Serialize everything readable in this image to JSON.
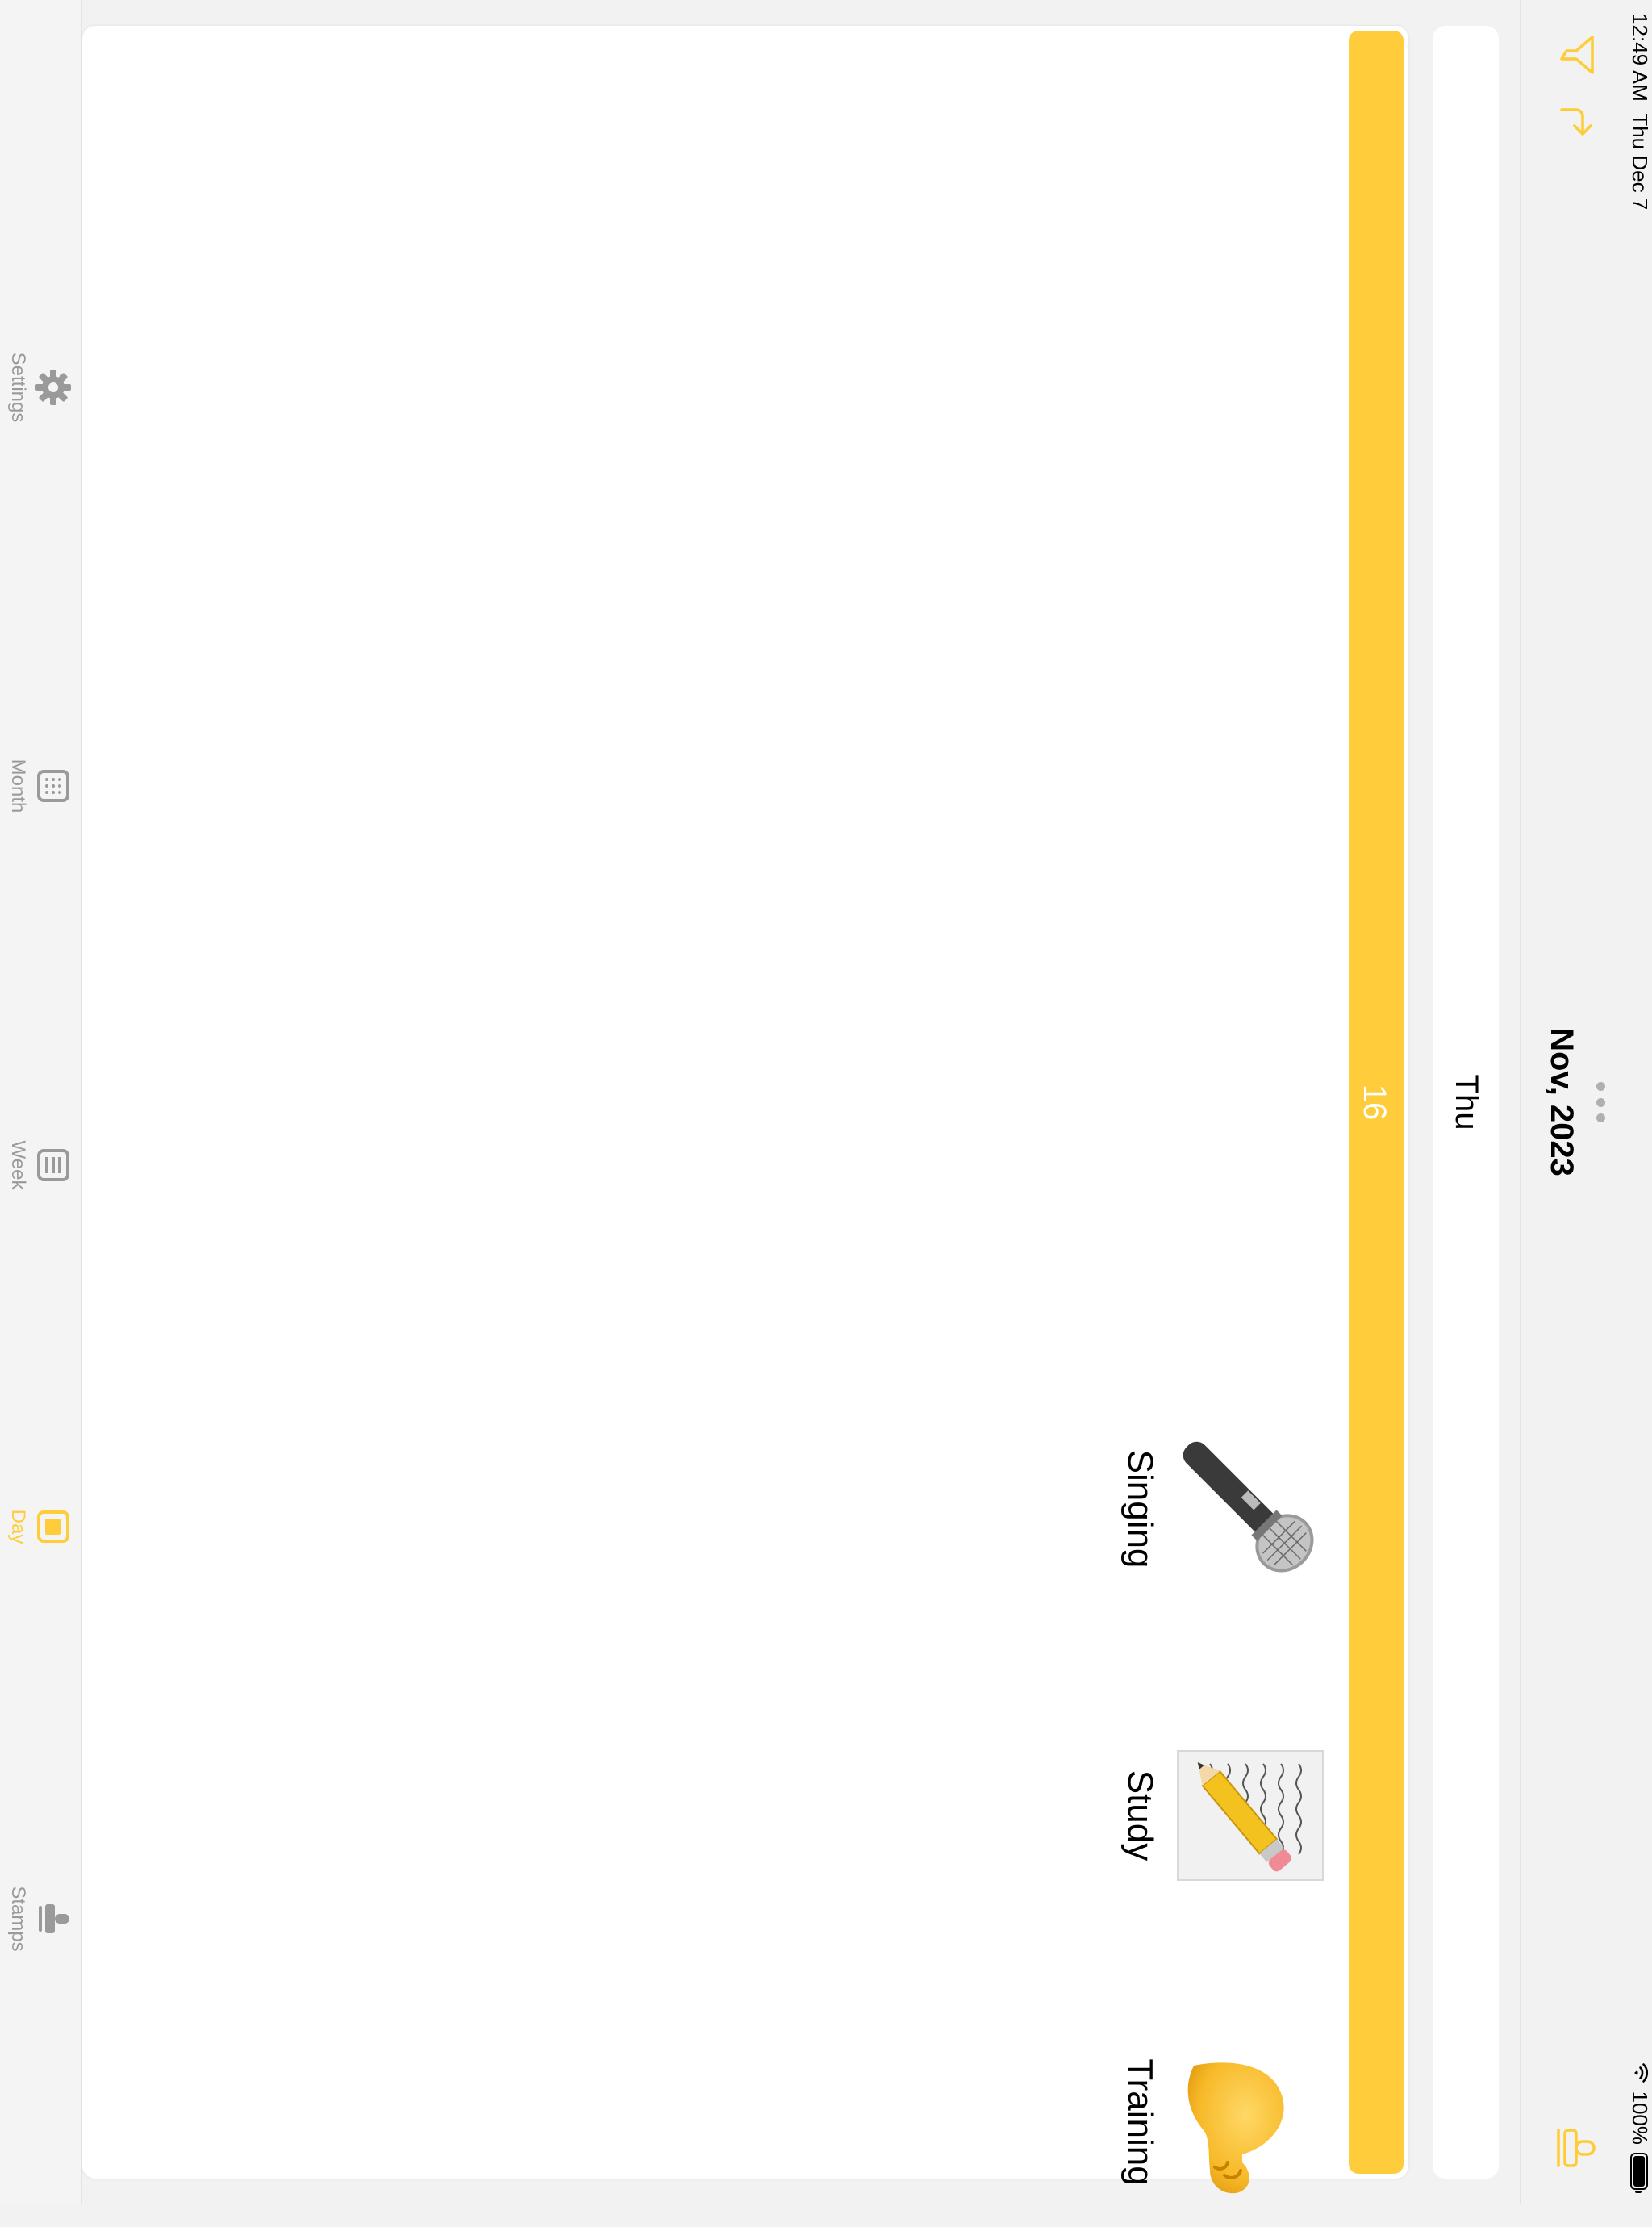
{
  "status_bar": {
    "time": "12:49 AM",
    "date": "Thu Dec 7",
    "battery": "100%"
  },
  "nav": {
    "title": "Nov, 2023"
  },
  "day_header": {
    "weekday": "Thu"
  },
  "day_bar": {
    "day_number": "16"
  },
  "stamps": [
    {
      "label": "Training",
      "icon": "flexed-biceps-icon"
    },
    {
      "label": "Study",
      "icon": "memo-pencil-icon"
    },
    {
      "label": "Singing",
      "icon": "microphone-icon"
    }
  ],
  "tabs": [
    {
      "label": "Stamps",
      "icon": "stamp-icon",
      "active": false
    },
    {
      "label": "Day",
      "icon": "day-icon",
      "active": true
    },
    {
      "label": "Week",
      "icon": "week-icon",
      "active": false
    },
    {
      "label": "Month",
      "icon": "month-icon",
      "active": false
    },
    {
      "label": "Settings",
      "icon": "gear-icon",
      "active": false
    }
  ],
  "colors": {
    "accent": "#ffcc3b",
    "inactive": "#9a9a9a"
  }
}
